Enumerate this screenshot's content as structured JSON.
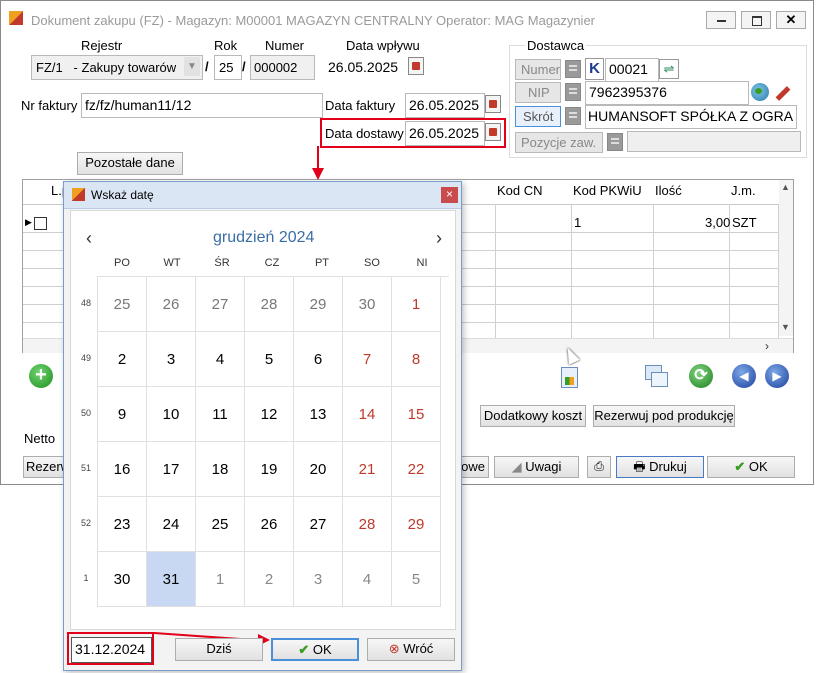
{
  "window": {
    "title": "Dokument zakupu (FZ) - Magazyn: M00001 MAGAZYN CENTRALNY  Operator: MAG Magazynier"
  },
  "header": {
    "rejestr_label": "Rejestr",
    "rok_label": "Rok",
    "numer_label": "Numer",
    "data_wplywu_label": "Data wpływu",
    "rejestr_value": "FZ/1   - Zakupy towarów",
    "rok_value": "25",
    "numer_value": "000002",
    "data_wplywu_value": "26.05.2025",
    "slash": "/",
    "nr_faktury_label": "Nr faktury",
    "nr_faktury_value": "fz/fz/human11/12",
    "data_faktury_label": "Data faktury",
    "data_faktury_value": "26.05.2025",
    "data_dostawy_label": "Data dostawy",
    "data_dostawy_value": "26.05.2025",
    "pozostale_button": "Pozostałe dane"
  },
  "dostawca": {
    "group_label": "Dostawca",
    "numer_button": "Numer",
    "k_badge": "K",
    "numer_value": "00021",
    "nip_button": "NIP",
    "nip_value": "7962395376",
    "skrot_button": "Skrót",
    "skrot_value": "HUMANSOFT SPÓŁKA Z OGRA",
    "pozycje_button": "Pozycje zaw."
  },
  "table": {
    "columns": [
      "L.p.",
      "Kod CN",
      "Kod PKWiU",
      "Ilość",
      "J.m."
    ],
    "row1": {
      "pkwiu": "1",
      "ilosc": "3,00",
      "jm": "SZT"
    }
  },
  "bottom": {
    "netto_label": "Netto",
    "rezerw_partial": "Rezerw",
    "owe_partial": "owe",
    "dodatkowy_koszt": "Dodatkowy koszt",
    "rezerwuj": "Rezerwuj pod produkcję",
    "uwagi": "Uwagi",
    "drukuj": "Drukuj",
    "ok": "OK"
  },
  "dialog": {
    "title": "Wskaż datę",
    "month": "grudzień 2024",
    "prev": "‹",
    "next": "›",
    "days": [
      "PO",
      "WT",
      "ŚR",
      "CZ",
      "PT",
      "SO",
      "NI"
    ],
    "weeks": [
      "48",
      "49",
      "50",
      "51",
      "52",
      "1"
    ],
    "rows": [
      [
        "25",
        "26",
        "27",
        "28",
        "29",
        "30",
        "1"
      ],
      [
        "2",
        "3",
        "4",
        "5",
        "6",
        "7",
        "8"
      ],
      [
        "9",
        "10",
        "11",
        "12",
        "13",
        "14",
        "15"
      ],
      [
        "16",
        "17",
        "18",
        "19",
        "20",
        "21",
        "22"
      ],
      [
        "23",
        "24",
        "25",
        "26",
        "27",
        "28",
        "29"
      ],
      [
        "30",
        "31",
        "1",
        "2",
        "3",
        "4",
        "5"
      ]
    ],
    "selected_date": "31.12.2024",
    "dzis_button": "Dziś",
    "ok_button": "OK",
    "wroc_button": "Wróć",
    "close": "×"
  },
  "colors": {
    "accent_red": "#e3001b",
    "month_blue": "#3a6ea5",
    "weekend_red": "#c0392b",
    "selected_bg": "#c8d8f2",
    "title_bar": "#dbe6f4",
    "ok_check": "#3a9d23"
  }
}
